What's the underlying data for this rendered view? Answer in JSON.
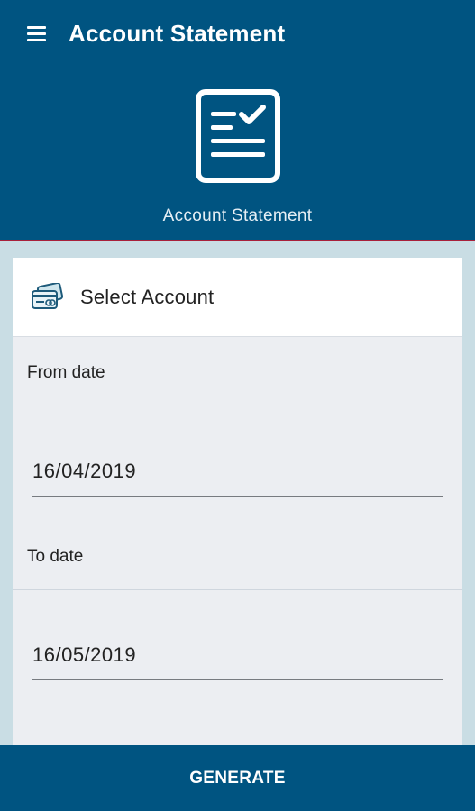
{
  "app_bar": {
    "title": "Account Statement",
    "menu_icon": "hamburger-menu-icon"
  },
  "hero": {
    "icon": "document-check-icon",
    "label": "Account Statement"
  },
  "account": {
    "icon": "card-icon",
    "label": "Select Account"
  },
  "from_date": {
    "label": "From date",
    "value": "16/04/2019"
  },
  "to_date": {
    "label": "To date",
    "value": "16/05/2019"
  },
  "footer": {
    "generate_label": "GENERATE"
  },
  "colors": {
    "primary": "#005481",
    "accent_line": "#a8213b",
    "page_bg": "#c9dde4",
    "panel_bg": "#eceef2"
  }
}
